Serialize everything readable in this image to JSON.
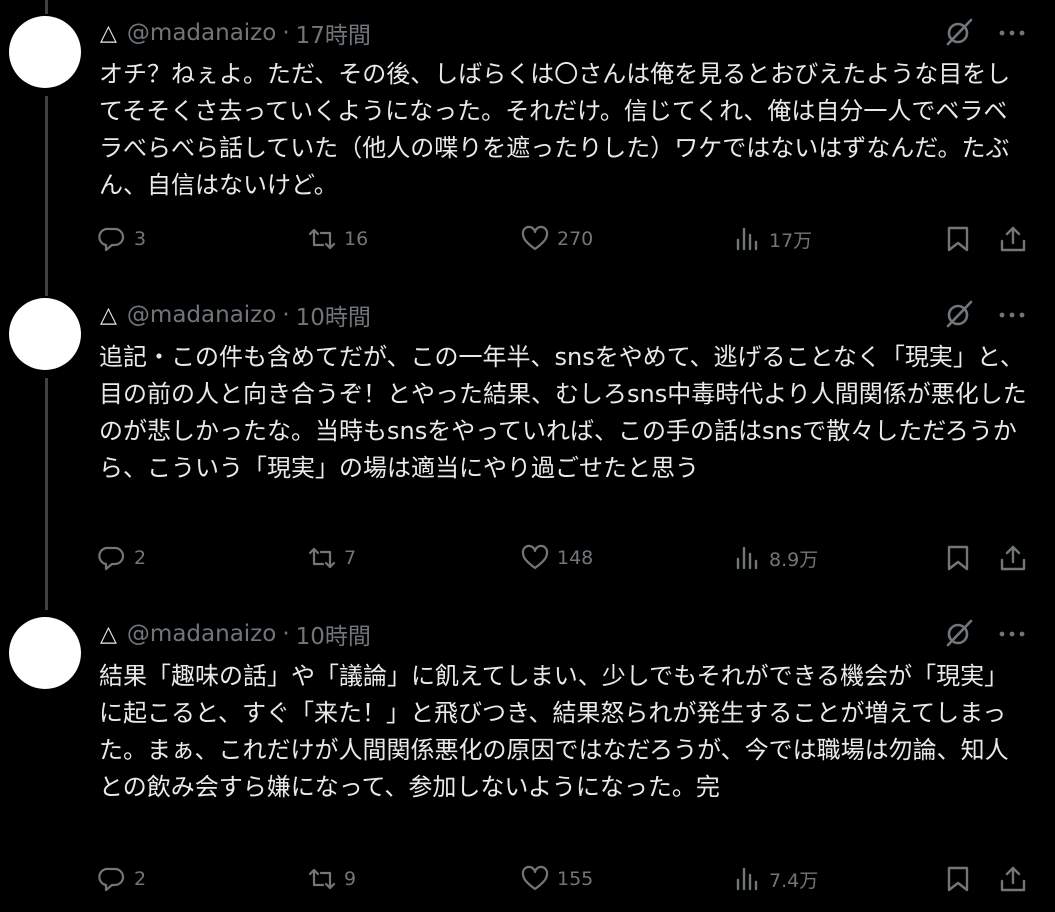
{
  "tweets": [
    {
      "symbol": "△",
      "handle": "@madanaizo",
      "separator": "·",
      "time": "17時間",
      "text": "オチ？ねぇよ。ただ、その後、しばらくは〇さんは俺を見るとおびえたような目をしてそそくさ去っていくようになった。それだけ。信じてくれ、俺は自分一人でベラベラべらべら話していた（他人の喋りを遮ったりした）ワケではないはずなんだ。たぶん、自信はないけど。",
      "replies": "3",
      "reposts": "16",
      "likes": "270",
      "views": "17万"
    },
    {
      "symbol": "△",
      "handle": "@madanaizo",
      "separator": "·",
      "time": "10時間",
      "text": "追記・この件も含めてだが、この一年半、snsをやめて、逃げることなく「現実」と、目の前の人と向き合うぞ！とやった結果、むしろsns中毒時代より人間関係が悪化したのが悲しかったな。当時もsnsをやっていれば、この手の話はsnsで散々しただろうから、こういう「現実」の場は適当にやり過ごせたと思う",
      "replies": "2",
      "reposts": "7",
      "likes": "148",
      "views": "8.9万"
    },
    {
      "symbol": "△",
      "handle": "@madanaizo",
      "separator": "·",
      "time": "10時間",
      "text": "結果「趣味の話」や「議論」に飢えてしまい、少しでもそれができる機会が「現実」に起こると、すぐ「来た！」と飛びつき、結果怒られが発生することが増えてしまった。まぁ、これだけが人間関係悪化の原因ではなだろうが、今では職場は勿論、知人との飲み会すら嫌になって、参加しないようになった。完",
      "replies": "2",
      "reposts": "9",
      "likes": "155",
      "views": "7.4万"
    }
  ],
  "icons": {
    "grok": "grok-icon",
    "more": "more-icon",
    "reply": "reply-icon",
    "repost": "repost-icon",
    "like": "like-icon",
    "views": "views-icon",
    "bookmark": "bookmark-icon",
    "share": "share-icon"
  },
  "colors": {
    "background": "#000000",
    "text": "#e7e9ea",
    "muted": "#71767b",
    "thread_line": "#3d4146"
  }
}
